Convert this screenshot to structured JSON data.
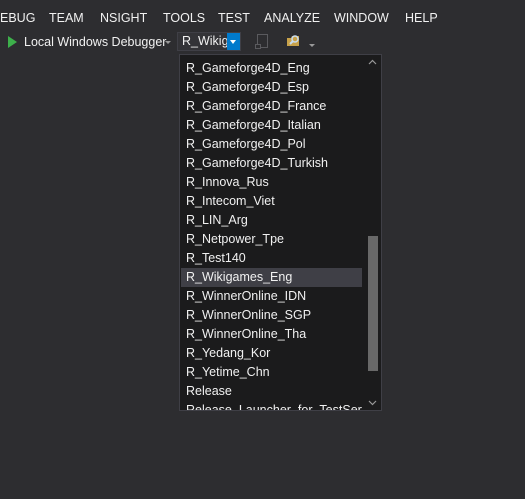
{
  "menu": {
    "items": [
      "EBUG",
      "TEAM",
      "NSIGHT",
      "TOOLS",
      "TEST",
      "ANALYZE",
      "WINDOW",
      "HELP"
    ]
  },
  "toolbar": {
    "debugger_label": "Local Windows Debugger",
    "config_value": "R_Wikigames_Eng"
  },
  "dropdown": {
    "items": [
      "R_Gameforge4D_Eng",
      "R_Gameforge4D_Esp",
      "R_Gameforge4D_France",
      "R_Gameforge4D_Italian",
      "R_Gameforge4D_Pol",
      "R_Gameforge4D_Turkish",
      "R_Innova_Rus",
      "R_Intecom_Viet",
      "R_LIN_Arg",
      "R_Netpower_Tpe",
      "R_Test140",
      "R_Wikigames_Eng",
      "R_WinnerOnline_IDN",
      "R_WinnerOnline_SGP",
      "R_WinnerOnline_Tha",
      "R_Yedang_Kor",
      "R_Yetime_Chn",
      "Release",
      "Release_Launcher_for_TestServer"
    ],
    "selected": "R_Wikigames_Eng"
  },
  "colors": {
    "background": "#2d2d30",
    "dropdown_bg": "#1b1b1c",
    "selection": "#3f3f46",
    "accent": "#007acc",
    "play_green": "#3db04b"
  }
}
